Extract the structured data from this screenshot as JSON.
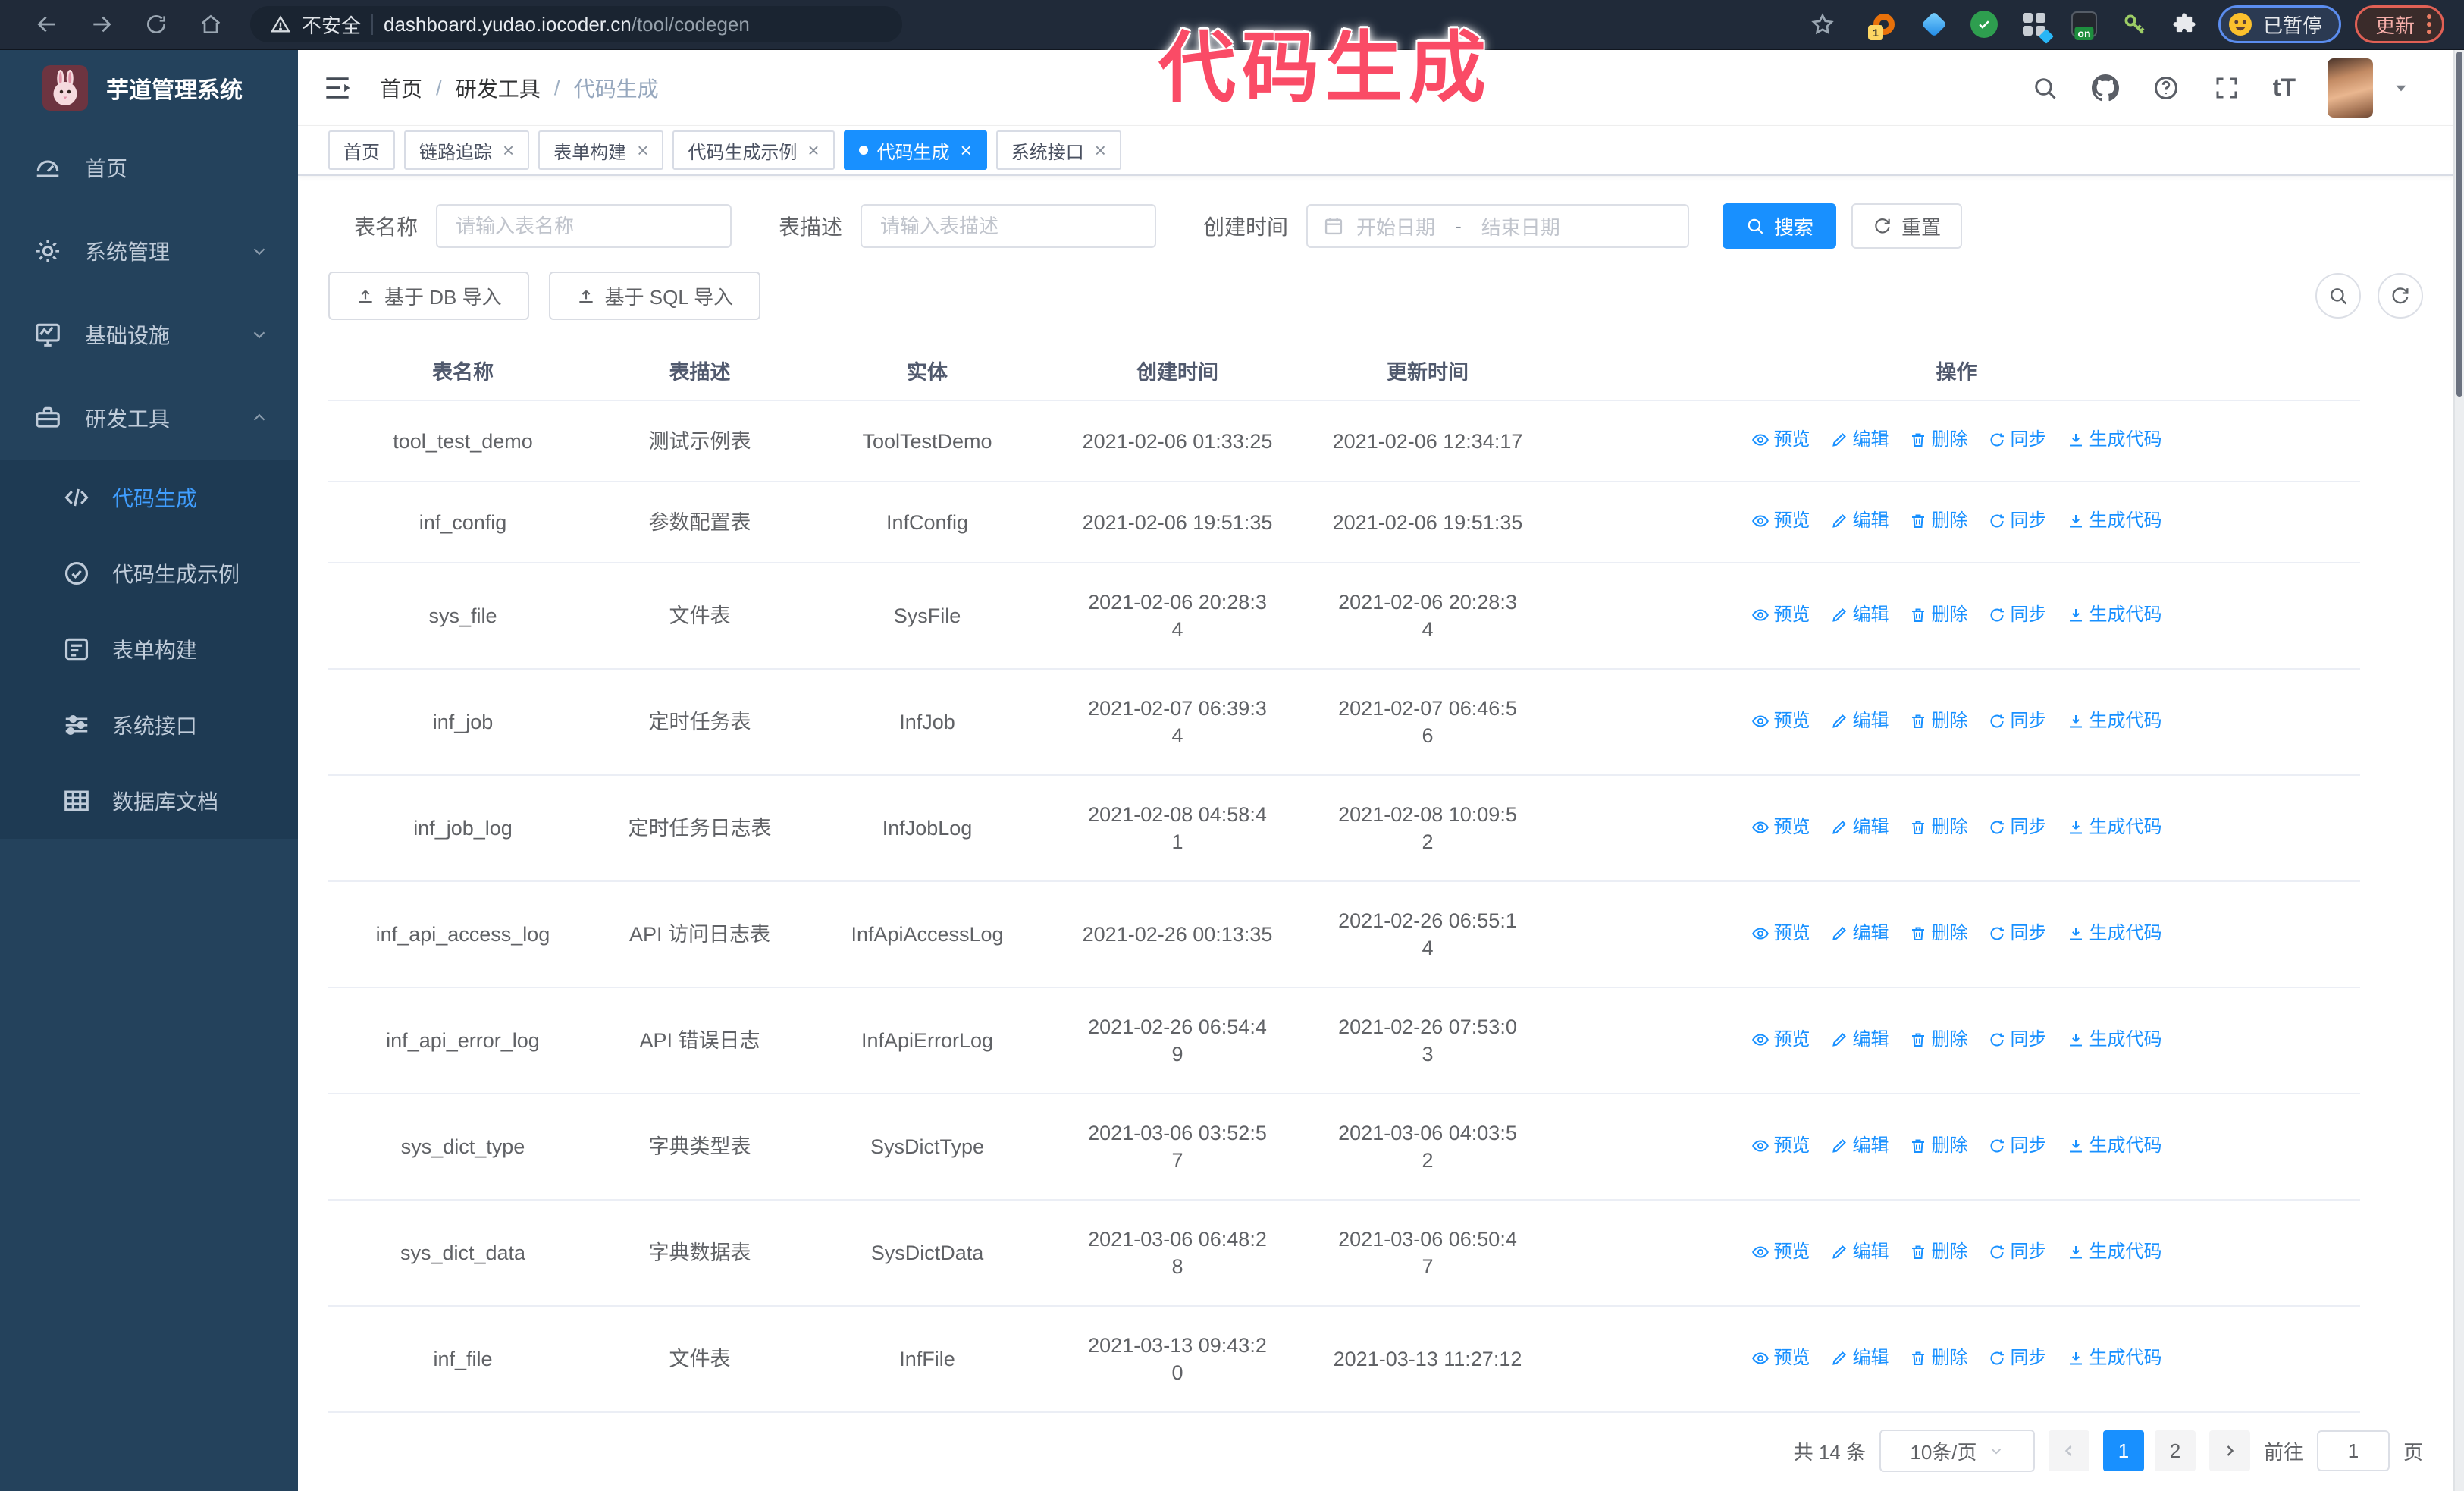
{
  "theme": {
    "accent": "#1890ff",
    "sidebar_bg": "#24425c",
    "submenu_bg": "#1e3a53",
    "browser_bar_bg": "#202a39",
    "overlay_color": "#fa4b66",
    "tag_active_bg": "#1890ff",
    "sidebar_active_text": "#409eff"
  },
  "overlay": {
    "text": "代码生成"
  },
  "browser": {
    "security_label": "不安全",
    "url_host": "dashboard.yudao.iocoder.cn",
    "url_path": "/tool/codegen",
    "profile_label": "已暂停",
    "update_label": "更新",
    "extension_badge_1": "1",
    "extension_badge_on": "on"
  },
  "sidebar": {
    "title": "芋道管理系统",
    "menu": [
      {
        "name": "home",
        "label": "首页",
        "icon": "dashboard",
        "caret": ""
      },
      {
        "name": "system",
        "label": "系统管理",
        "icon": "gear",
        "caret": "down"
      },
      {
        "name": "infra",
        "label": "基础设施",
        "icon": "monitor",
        "caret": "down"
      },
      {
        "name": "devtools",
        "label": "研发工具",
        "icon": "toolbox",
        "caret": "up"
      }
    ],
    "submenu": [
      {
        "name": "codegen",
        "label": "代码生成",
        "icon": "code",
        "active": true
      },
      {
        "name": "codegen-example",
        "label": "代码生成示例",
        "icon": "badge",
        "active": false
      },
      {
        "name": "form-builder",
        "label": "表单构建",
        "icon": "form",
        "active": false
      },
      {
        "name": "system-api",
        "label": "系统接口",
        "icon": "sliders",
        "active": false
      },
      {
        "name": "db-doc",
        "label": "数据库文档",
        "icon": "dbtable",
        "active": false
      }
    ]
  },
  "navbar": {
    "font_size_icon_text": "tT"
  },
  "header": {
    "breadcrumb": [
      "首页",
      "研发工具",
      "代码生成"
    ]
  },
  "tags": [
    {
      "name": "home",
      "label": "首页",
      "closable": false,
      "active": false
    },
    {
      "name": "trace",
      "label": "链路追踪",
      "closable": true,
      "active": false
    },
    {
      "name": "form-builder",
      "label": "表单构建",
      "closable": true,
      "active": false
    },
    {
      "name": "codegen-example",
      "label": "代码生成示例",
      "closable": true,
      "active": false
    },
    {
      "name": "codegen",
      "label": "代码生成",
      "closable": true,
      "active": true
    },
    {
      "name": "system-api",
      "label": "系统接口",
      "closable": true,
      "active": false
    }
  ],
  "filters": {
    "table_name_label": "表名称",
    "table_name_placeholder": "请输入表名称",
    "table_desc_label": "表描述",
    "table_desc_placeholder": "请输入表描述",
    "create_time_label": "创建时间",
    "start_date_placeholder": "开始日期",
    "range_separator": "-",
    "end_date_placeholder": "结束日期",
    "search_label": "搜索",
    "reset_label": "重置"
  },
  "toolbar": {
    "import_db_label": "基于 DB 导入",
    "import_sql_label": "基于 SQL 导入"
  },
  "table": {
    "columns": [
      "表名称",
      "表描述",
      "实体",
      "创建时间",
      "更新时间",
      "操作"
    ],
    "actions": [
      {
        "name": "preview",
        "label": "预览",
        "icon": "eye"
      },
      {
        "name": "edit",
        "label": "编辑",
        "icon": "edit"
      },
      {
        "name": "delete",
        "label": "删除",
        "icon": "del"
      },
      {
        "name": "sync",
        "label": "同步",
        "icon": "sync"
      },
      {
        "name": "generate-code",
        "label": "生成代码",
        "icon": "down"
      }
    ],
    "rows": [
      {
        "name": "tool_test_demo",
        "desc": "测试示例表",
        "entity": "ToolTestDemo",
        "created": "2021-02-06 01:33:25",
        "updated": "2021-02-06 12:34:17"
      },
      {
        "name": "inf_config",
        "desc": "参数配置表",
        "entity": "InfConfig",
        "created": "2021-02-06 19:51:35",
        "updated": "2021-02-06 19:51:35"
      },
      {
        "name": "sys_file",
        "desc": "文件表",
        "entity": "SysFile",
        "created": "2021-02-06 20:28:3\n4",
        "updated": "2021-02-06 20:28:3\n4"
      },
      {
        "name": "inf_job",
        "desc": "定时任务表",
        "entity": "InfJob",
        "created": "2021-02-07 06:39:3\n4",
        "updated": "2021-02-07 06:46:5\n6"
      },
      {
        "name": "inf_job_log",
        "desc": "定时任务日志表",
        "entity": "InfJobLog",
        "created": "2021-02-08 04:58:4\n1",
        "updated": "2021-02-08 10:09:5\n2"
      },
      {
        "name": "inf_api_access_log",
        "desc": "API 访问日志表",
        "entity": "InfApiAccessLog",
        "created": "2021-02-26 00:13:35",
        "updated": "2021-02-26 06:55:1\n4"
      },
      {
        "name": "inf_api_error_log",
        "desc": "API 错误日志",
        "entity": "InfApiErrorLog",
        "created": "2021-02-26 06:54:4\n9",
        "updated": "2021-02-26 07:53:0\n3"
      },
      {
        "name": "sys_dict_type",
        "desc": "字典类型表",
        "entity": "SysDictType",
        "created": "2021-03-06 03:52:5\n7",
        "updated": "2021-03-06 04:03:5\n2"
      },
      {
        "name": "sys_dict_data",
        "desc": "字典数据表",
        "entity": "SysDictData",
        "created": "2021-03-06 06:48:2\n8",
        "updated": "2021-03-06 06:50:4\n7"
      },
      {
        "name": "inf_file",
        "desc": "文件表",
        "entity": "InfFile",
        "created": "2021-03-13 09:43:2\n0",
        "updated": "2021-03-13 11:27:12"
      }
    ]
  },
  "pagination": {
    "total_label": "共 14 条",
    "page_size_label": "10条/页",
    "pages": [
      "1",
      "2"
    ],
    "active_page": "1",
    "goto_label": "前往",
    "goto_value": "1",
    "page_suffix": "页"
  }
}
